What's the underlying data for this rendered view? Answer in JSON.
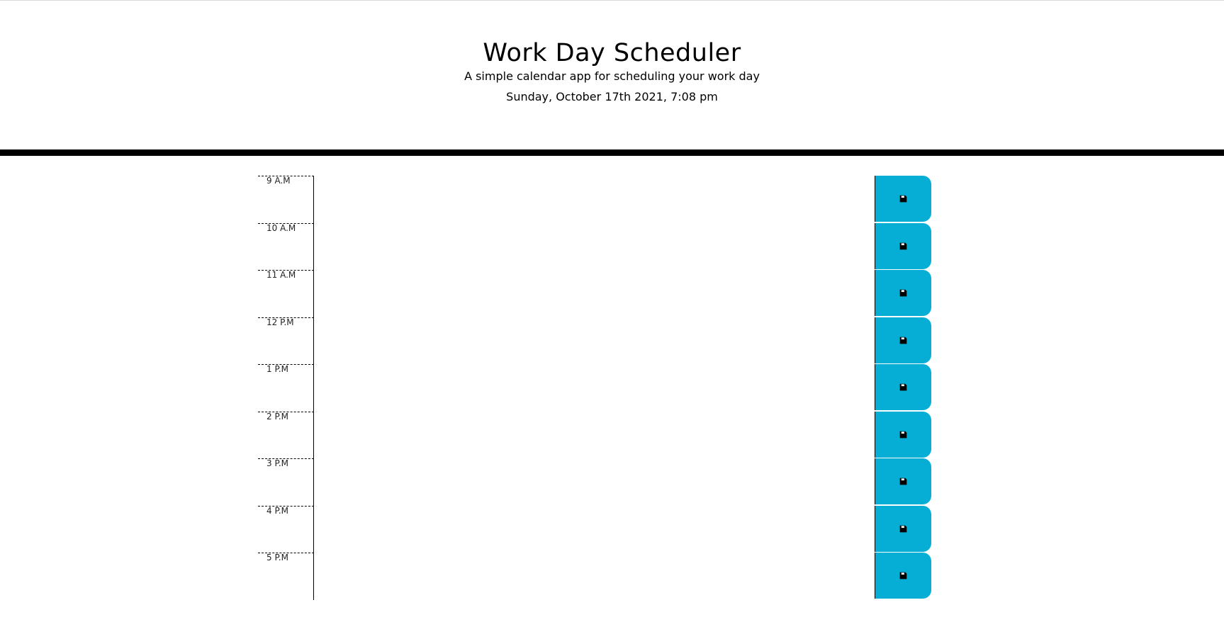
{
  "header": {
    "title": "Work Day Scheduler",
    "subtitle": "A simple calendar app for scheduling your work day",
    "current_day": "Sunday, October 17th 2021, 7:08 pm"
  },
  "colors": {
    "save_button": "#06aed5",
    "header_bar": "#000000"
  },
  "time_blocks": [
    {
      "hour": "9 A.M",
      "description": "",
      "save_icon": "save-icon"
    },
    {
      "hour": "10 A.M",
      "description": "",
      "save_icon": "save-icon"
    },
    {
      "hour": "11 A.M",
      "description": "",
      "save_icon": "save-icon"
    },
    {
      "hour": "12 P.M",
      "description": "",
      "save_icon": "save-icon"
    },
    {
      "hour": "1 P.M",
      "description": "",
      "save_icon": "save-icon"
    },
    {
      "hour": "2 P.M",
      "description": "",
      "save_icon": "save-icon"
    },
    {
      "hour": "3 P.M",
      "description": "",
      "save_icon": "save-icon"
    },
    {
      "hour": "4 P.M",
      "description": "",
      "save_icon": "save-icon"
    },
    {
      "hour": "5 P.M",
      "description": "",
      "save_icon": "save-icon"
    }
  ]
}
